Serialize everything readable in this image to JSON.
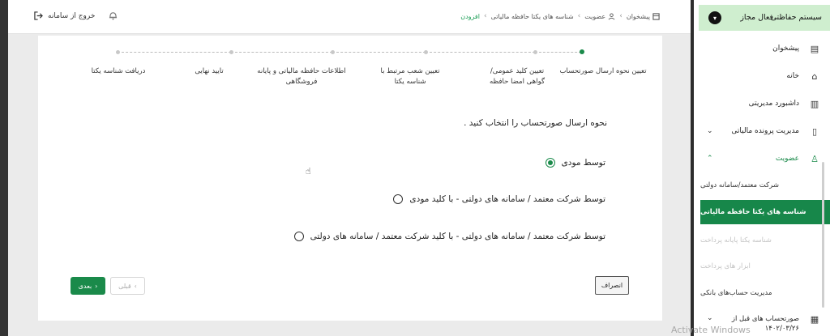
{
  "header": {
    "logout_label": "خروج از سامانه",
    "breadcrumb": [
      "پیشخوان",
      "عضویت",
      "شناسه های یکتا حافظه مالیاتی",
      "افزودن"
    ]
  },
  "stepper": {
    "steps": [
      {
        "label": "تعیین نحوه ارسال صورتحساب",
        "active": true
      },
      {
        "label": "تعیین کلید عمومی/گواهی امضا حافظه",
        "active": false
      },
      {
        "label": "تعیین شعب مرتبط با شناسه یکتا",
        "active": false
      },
      {
        "label": "اطلاعات حافظه مالیاتی و پایانه فروشگاهی",
        "active": false
      },
      {
        "label": "تایید نهایی",
        "active": false
      },
      {
        "label": "دریافت شناسه یکتا",
        "active": false
      }
    ]
  },
  "form": {
    "question": "نحوه ارسال صورتحساب را انتخاب کنید .",
    "options": [
      {
        "label": "توسط مودی",
        "checked": true
      },
      {
        "label": "توسط شرکت معتمد / سامانه های دولتی - با کلید مودی",
        "checked": false
      },
      {
        "label": "توسط شرکت معتمد / سامانه های دولتی - با کلید شرکت معتمد / سامانه های دولتی",
        "checked": false
      }
    ]
  },
  "buttons": {
    "next": "بعدی",
    "prev": "قبلی",
    "cancel": "انصراف"
  },
  "sidebar": {
    "system_title": "سیستم حفاظتی",
    "active_label": "فعال مجاز",
    "items": [
      {
        "label": "پیشخوان",
        "icon": "dashboard-icon"
      },
      {
        "label": "خانه",
        "icon": "home-icon"
      },
      {
        "label": "داشبورد مدیریتی",
        "icon": "chart-icon"
      },
      {
        "label": "مدیریت پرونده مالیاتی",
        "icon": "file-icon"
      },
      {
        "label": "عضویت",
        "icon": "user-icon"
      }
    ],
    "sub_items": [
      {
        "label": "شرکت معتمد/سامانه دولتی",
        "state": "normal"
      },
      {
        "label": "شناسه های یکتا حافظه مالیاتی",
        "state": "active"
      },
      {
        "label": "شناسه یکتا پایانه پرداخت",
        "state": "disabled"
      },
      {
        "label": "ابزار های پرداخت",
        "state": "disabled"
      },
      {
        "label": "مدیریت حساب‌های بانکی",
        "state": "normal"
      }
    ],
    "last_item": {
      "label": "صورتحساب های قبل از ۱۴۰۲/۰۳/۲۶",
      "icon": "receipt-icon"
    }
  },
  "watermark": "Activate Windows",
  "colors": {
    "primary_green": "#1a8a4a",
    "sidebar_header_bg": "#cfeecf"
  }
}
